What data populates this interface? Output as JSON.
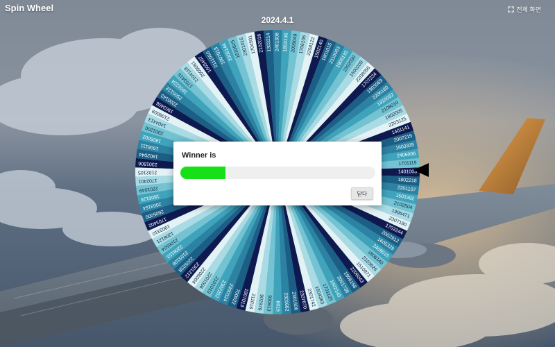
{
  "app": {
    "logo_text": "Spin Wheel"
  },
  "toolbar": {
    "fullscreen_label": "전체 화면",
    "fullscreen_icon": "fullscreen-icon"
  },
  "wheel": {
    "title": "2024.4.1",
    "palette": [
      "#0e1a4f",
      "#1c5f86",
      "#2c82a2",
      "#3fa3bc",
      "#73c3d2",
      "#a8dbe4",
      "#e3f2f5"
    ],
    "entries": [
      "1401003",
      "1802218",
      "2201107",
      "1503392",
      "2102504",
      "1906471",
      "2307180",
      "1702244",
      "2002912",
      "1605329",
      "2409015",
      "1808140",
      "2103626",
      "1510871",
      "2206043",
      "1906158",
      "2001739",
      "1602143",
      "1701125",
      "1604363",
      "2301742",
      "2307670",
      "2301606",
      "2301662",
      "8015",
      "930613",
      "902979",
      "211016",
      "1807013",
      "700022",
      "2300324",
      "2302202",
      "2101010",
      "2201506",
      "2206004",
      "2301212",
      "2205038",
      "2103108",
      "2208153",
      "2106504",
      "1308121",
      "1903310",
      "1703402",
      "2605000",
      "2003154",
      "1806126",
      "2201049",
      "1702401",
      "2102105",
      "2301806",
      "1902044",
      "1606111",
      "1805002",
      "2301200",
      "1404413",
      "2108009",
      "1903406",
      "2200143",
      "2505122",
      "1601224",
      "1703415",
      "2104118",
      "2009081",
      "1603407",
      "2111050",
      "1907013",
      "2005144",
      "1810025",
      "2301016",
      "1704501",
      "2102016",
      "1303214",
      "2401308",
      "1803136",
      "2009049",
      "1706106",
      "2208122",
      "1502140",
      "1801015",
      "2110063",
      "1905133",
      "2302030",
      "1600209",
      "2208056",
      "1707234",
      "1903069",
      "2206180",
      "1310032",
      "2108010",
      "1802005",
      "2203125",
      "1401141",
      "2007215",
      "1603335",
      "2406006",
      "1701119"
    ]
  },
  "dialog": {
    "title": "Winner is",
    "progress_fraction": 0.23,
    "progress_color": "#18e018",
    "close_label": "닫다"
  }
}
